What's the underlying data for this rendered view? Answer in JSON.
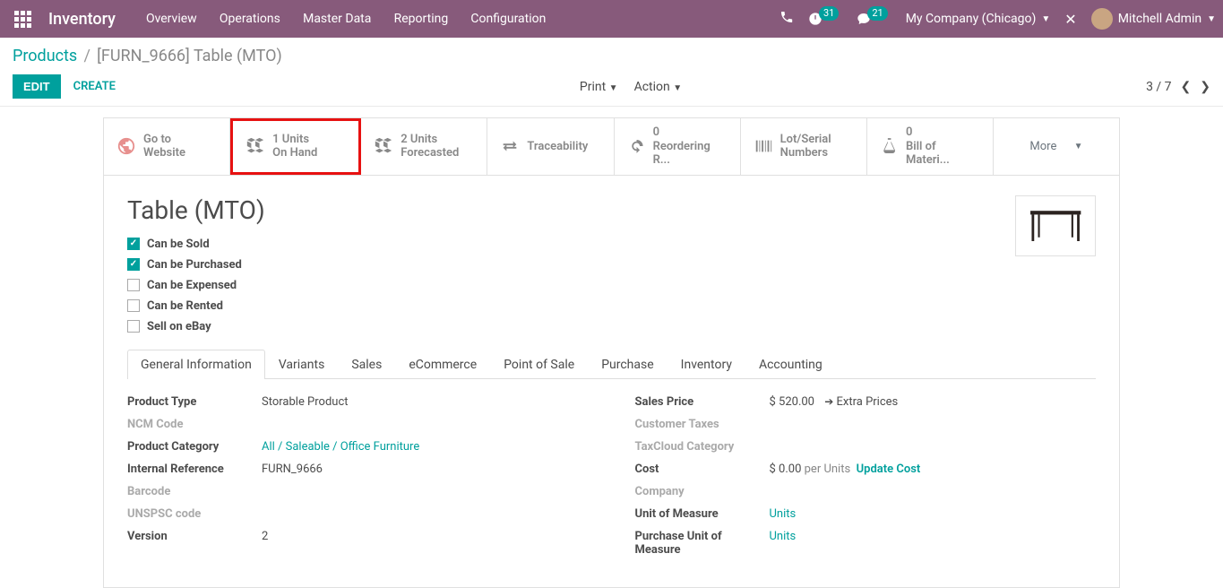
{
  "topbar": {
    "app": "Inventory",
    "menu": [
      "Overview",
      "Operations",
      "Master Data",
      "Reporting",
      "Configuration"
    ],
    "clock_badge": "31",
    "chat_badge": "21",
    "company": "My Company (Chicago)",
    "user": "Mitchell Admin"
  },
  "breadcrumb": {
    "root": "Products",
    "current": "[FURN_9666] Table (MTO)"
  },
  "controls": {
    "edit": "EDIT",
    "create": "CREATE",
    "print": "Print",
    "action": "Action",
    "pager": "3 / 7"
  },
  "stats": {
    "website": {
      "l1": "Go to",
      "l2": "Website"
    },
    "onhand": {
      "l1": "1 Units",
      "l2": "On Hand"
    },
    "forecast": {
      "l1": "2 Units",
      "l2": "Forecasted"
    },
    "trace": {
      "l1": "Traceability"
    },
    "reorder": {
      "l1": "0",
      "l2": "Reordering R..."
    },
    "lot": {
      "l1": "Lot/Serial",
      "l2": "Numbers"
    },
    "bom": {
      "l1": "0",
      "l2": "Bill of Materi..."
    },
    "more": "More"
  },
  "product": {
    "title": "Table (MTO)"
  },
  "checks": {
    "sold": "Can be Sold",
    "purchased": "Can be Purchased",
    "expensed": "Can be Expensed",
    "rented": "Can be Rented",
    "ebay": "Sell on eBay"
  },
  "tabs": [
    "General Information",
    "Variants",
    "Sales",
    "eCommerce",
    "Point of Sale",
    "Purchase",
    "Inventory",
    "Accounting"
  ],
  "left_fields": {
    "product_type": {
      "label": "Product Type",
      "value": "Storable Product"
    },
    "ncm": {
      "label": "NCM Code",
      "value": ""
    },
    "category": {
      "label": "Product Category",
      "value": "All / Saleable / Office Furniture"
    },
    "internal_ref": {
      "label": "Internal Reference",
      "value": "FURN_9666"
    },
    "barcode": {
      "label": "Barcode",
      "value": ""
    },
    "unspsc": {
      "label": "UNSPSC code",
      "value": ""
    },
    "version": {
      "label": "Version",
      "value": "2"
    }
  },
  "right_fields": {
    "sales_price": {
      "label": "Sales Price",
      "value": "$ 520.00",
      "extra": "Extra Prices"
    },
    "cust_taxes": {
      "label": "Customer Taxes",
      "value": ""
    },
    "taxcloud": {
      "label": "TaxCloud Category",
      "value": ""
    },
    "cost": {
      "label": "Cost",
      "value": "$ 0.00",
      "per": "per Units",
      "update": "Update Cost"
    },
    "company": {
      "label": "Company",
      "value": ""
    },
    "uom": {
      "label": "Unit of Measure",
      "value": "Units"
    },
    "puom": {
      "label": "Purchase Unit of Measure",
      "value": "Units"
    }
  }
}
